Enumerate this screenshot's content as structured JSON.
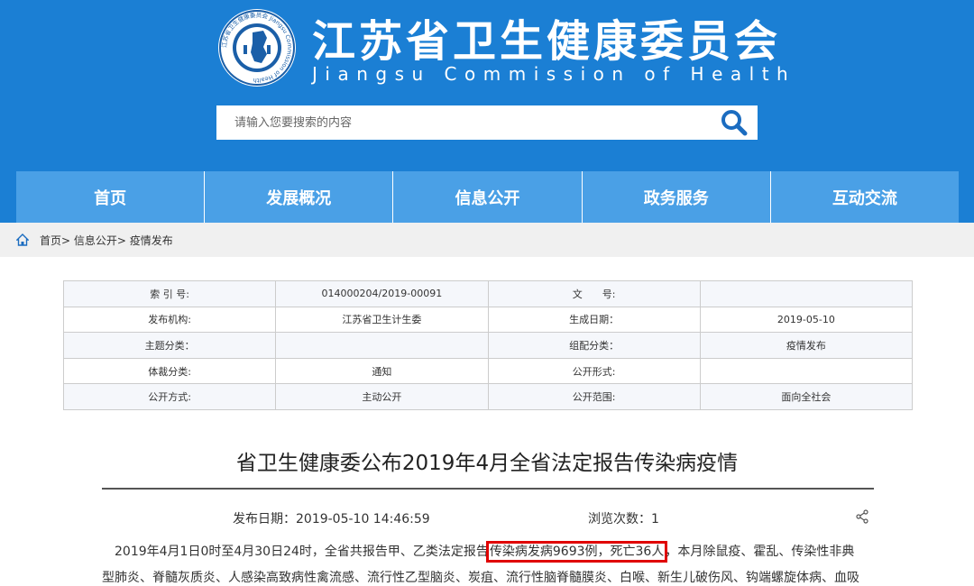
{
  "header": {
    "title": "江苏省卫生健康委员会",
    "subtitle": "Jiangsu Commission of Health",
    "emblem_icon": "provincial-emblem-icon",
    "emblem_ring_text": "江苏省卫生健康委员会 Jiangsu Commission of Health",
    "bg_color": "#1b7fd4"
  },
  "search": {
    "placeholder": "请输入您要搜索的内容",
    "button_icon": "search-icon"
  },
  "nav": {
    "items": [
      "首页",
      "发展概况",
      "信息公开",
      "政务服务",
      "互动交流"
    ],
    "bg_color": "#4aa0e6"
  },
  "breadcrumb": {
    "icon": "home-icon",
    "items": [
      "首页",
      "信息公开",
      "疫情发布"
    ],
    "separator": "> "
  },
  "meta": {
    "rows": [
      [
        "索 引 号:",
        "014000204/2019-00091",
        "文　　号:",
        ""
      ],
      [
        "发布机构:",
        "江苏省卫生计生委",
        "生成日期：",
        "2019-05-10"
      ],
      [
        "主题分类：",
        "",
        "组配分类：",
        "疫情发布"
      ],
      [
        "体裁分类:",
        "通知",
        "公开形式:",
        ""
      ],
      [
        "公开方式:",
        "主动公开",
        "公开范围:",
        "面向全社会"
      ]
    ]
  },
  "article": {
    "title": "省卫生健康委公布2019年4月全省法定报告传染病疫情",
    "pub_date": "发布日期：2019-05-10 14:46:59",
    "views": "浏览次数：1",
    "share_icon": "share-icon",
    "para1_before": "　2019年4月1日0时至4月30日24时，全省共报告甲、乙类法定报告",
    "para1_highlight": "传染病发病9693例，死亡36人",
    "para1_after": "，本月除鼠疫、霍乱、传染性非典",
    "para2": "型肺炎、脊髓灰质炎、人感染高致病性禽流感、流行性乙型脑炎、炭疽、流行性脑脊髓膜炎、白喉、新生儿破伤风、钩端螺旋体病、血吸",
    "highlight_color": "#e00000"
  }
}
